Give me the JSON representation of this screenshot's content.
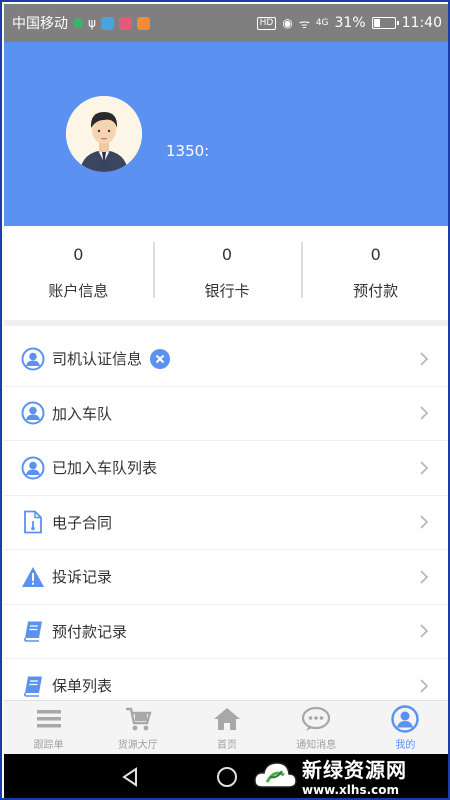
{
  "status_bar": {
    "carrier": "中国移动",
    "signal": "4G",
    "battery": "31%",
    "time": "11:40"
  },
  "profile": {
    "phone": "1350:"
  },
  "stats": [
    {
      "value": "0",
      "label": "账户信息"
    },
    {
      "value": "0",
      "label": "银行卡"
    },
    {
      "value": "0",
      "label": "预付款"
    }
  ],
  "menu": {
    "items": [
      {
        "label": "司机认证信息",
        "icon": "user-icon"
      },
      {
        "label": "加入车队",
        "icon": "user-icon"
      },
      {
        "label": "已加入车队列表",
        "icon": "user-icon"
      },
      {
        "label": "电子合同",
        "icon": "document-icon"
      },
      {
        "label": "投诉记录",
        "icon": "warning-icon"
      },
      {
        "label": "预付款记录",
        "icon": "book-icon"
      },
      {
        "label": "保单列表",
        "icon": "book-icon"
      }
    ]
  },
  "tabs": [
    {
      "label": "跟踪单",
      "icon": "list-icon"
    },
    {
      "label": "货源大厅",
      "icon": "cart-icon"
    },
    {
      "label": "首页",
      "icon": "home-icon"
    },
    {
      "label": "通知消息",
      "icon": "chat-icon"
    },
    {
      "label": "我的",
      "icon": "user-icon"
    }
  ],
  "watermark": {
    "title": "新绿资源网",
    "url": "www.xlhs.com"
  },
  "colors": {
    "accent": "#5b92f2",
    "statusbar": "#7f7f7f",
    "tab_inactive": "#a0a0a0"
  }
}
